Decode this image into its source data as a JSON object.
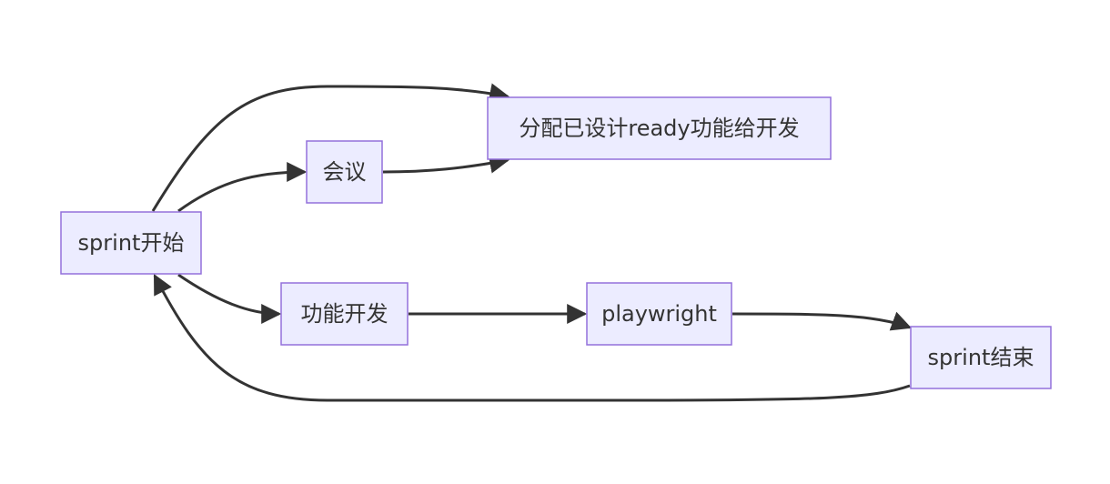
{
  "nodes": {
    "sprint_start": {
      "label": "sprint开始"
    },
    "meeting": {
      "label": "会议"
    },
    "assign": {
      "label": "分配已设计ready功能给开发"
    },
    "feature_dev": {
      "label": "功能开发"
    },
    "playwright": {
      "label": "playwright"
    },
    "sprint_end": {
      "label": "sprint结束"
    }
  },
  "edges": [
    {
      "from": "sprint_start",
      "to": "assign"
    },
    {
      "from": "sprint_start",
      "to": "meeting"
    },
    {
      "from": "meeting",
      "to": "assign"
    },
    {
      "from": "sprint_start",
      "to": "feature_dev"
    },
    {
      "from": "feature_dev",
      "to": "playwright"
    },
    {
      "from": "playwright",
      "to": "sprint_end"
    },
    {
      "from": "sprint_end",
      "to": "sprint_start"
    }
  ],
  "colors": {
    "node_fill": "#ECECFF",
    "node_stroke": "#9370DB",
    "edge": "#333333",
    "text": "#333333"
  }
}
